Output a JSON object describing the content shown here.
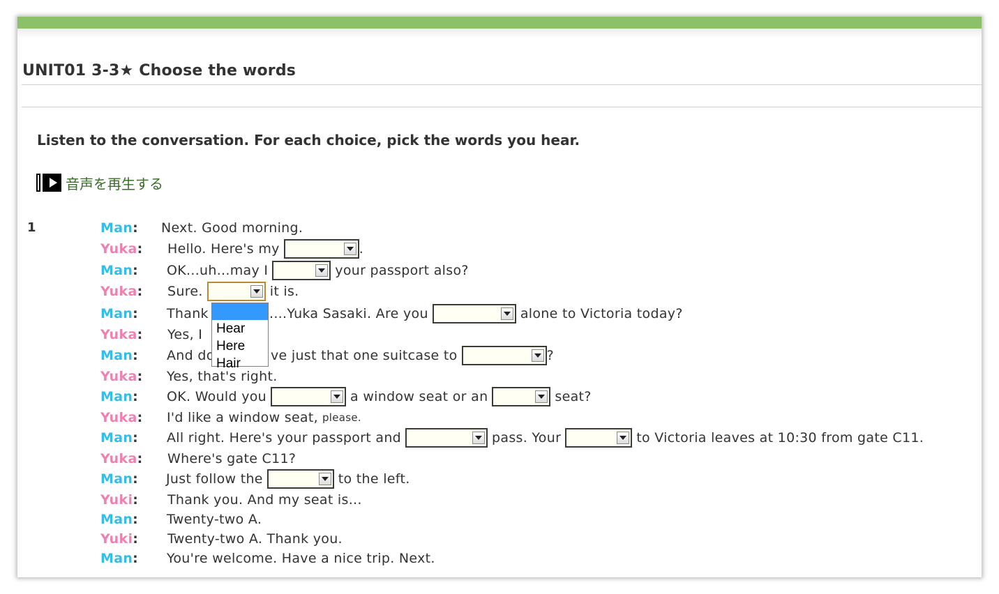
{
  "page": {
    "title": "UNIT01 3-3★ Choose the words",
    "instruction": "Listen to the conversation. For each choice, pick the words you hear.",
    "play_label": "音声を再生する",
    "question_number": "1",
    "icons": {
      "play": "play-icon"
    },
    "colors": {
      "topbar": "#8cc069",
      "man": "#33bde9",
      "yuka": "#f27fb2",
      "link": "#3a6e2a"
    }
  },
  "dialogue": [
    {
      "speaker": "Man",
      "parts": [
        "Next. Good morning."
      ]
    },
    {
      "speaker": "Yuka",
      "parts": [
        "Hello. Here's my",
        "."
      ]
    },
    {
      "speaker": "Man",
      "parts": [
        "OK...uh...may I",
        "your passport also?"
      ]
    },
    {
      "speaker": "Yuka",
      "parts": [
        "Sure.",
        "it is."
      ]
    },
    {
      "speaker": "Man",
      "parts": [
        "Thank",
        "....Yuka Sasaki. Are you",
        "alone to Victoria today?"
      ]
    },
    {
      "speaker": "Yuka",
      "parts": [
        "Yes, I"
      ]
    },
    {
      "speaker": "Man",
      "parts": [
        "And do",
        "ve just that one suitcase to",
        "?"
      ]
    },
    {
      "speaker": "Yuka",
      "parts": [
        "Yes, that's right."
      ]
    },
    {
      "speaker": "Man",
      "parts": [
        "OK. Would you",
        "a window seat or an",
        "seat?"
      ]
    },
    {
      "speaker": "Yuka",
      "parts": [
        "I'd like a window seat,",
        "please."
      ]
    },
    {
      "speaker": "Man",
      "parts": [
        "All right. Here's your passport and",
        "pass. Your",
        "to Victoria  leaves at 10:30 from gate C11."
      ]
    },
    {
      "speaker": "Yuka",
      "parts": [
        "Where's gate C11?"
      ]
    },
    {
      "speaker": "Man",
      "parts": [
        "Just follow the",
        "to the left."
      ]
    },
    {
      "speaker": "Yuki",
      "parts": [
        "Thank you. And my seat is..."
      ]
    },
    {
      "speaker": "Man",
      "parts": [
        "Twenty-two A."
      ]
    },
    {
      "speaker": "Yuki",
      "parts": [
        "Twenty-two A. Thank you."
      ]
    },
    {
      "speaker": "Man",
      "parts": [
        "You're welcome. Have a nice trip. Next."
      ]
    }
  ],
  "dropdown": {
    "options": [
      "Hear",
      "Here",
      "Hair"
    ]
  }
}
